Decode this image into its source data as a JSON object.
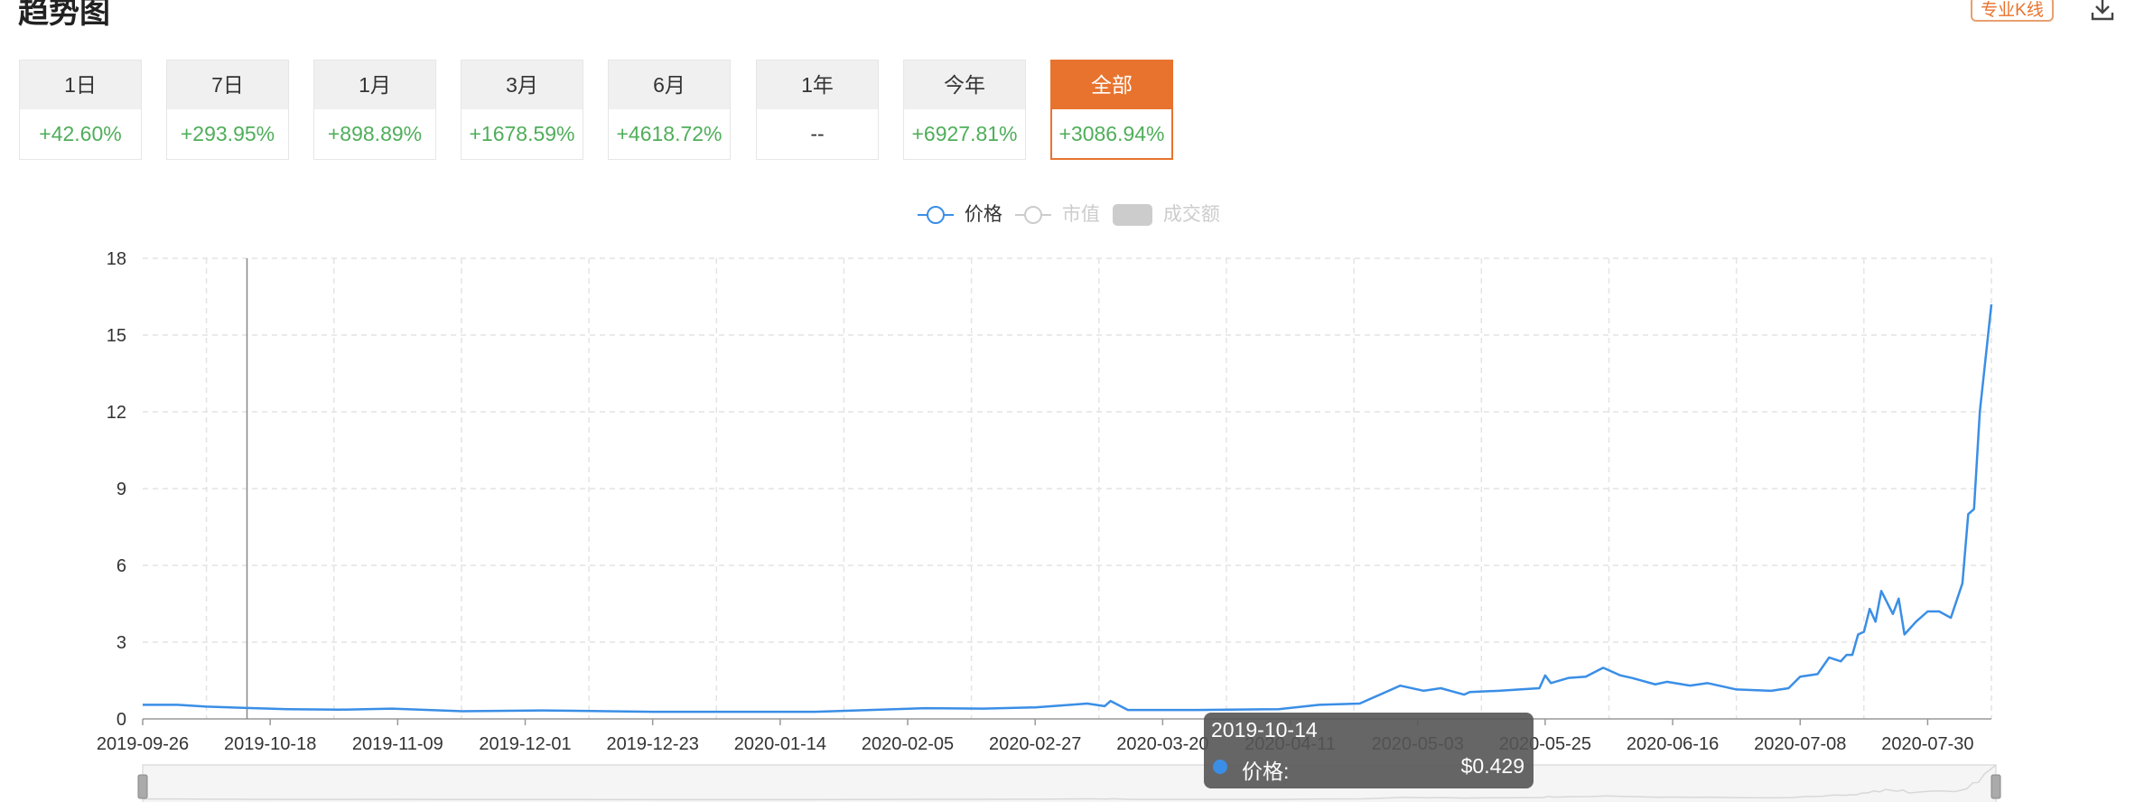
{
  "header": {
    "title": "趋势图",
    "kline_button": "专业K线",
    "download_icon": "download-icon"
  },
  "periods": [
    {
      "label": "1日",
      "change": "+42.60%"
    },
    {
      "label": "7日",
      "change": "+293.95%"
    },
    {
      "label": "1月",
      "change": "+898.89%"
    },
    {
      "label": "3月",
      "change": "+1678.59%"
    },
    {
      "label": "6月",
      "change": "+4618.72%"
    },
    {
      "label": "1年",
      "change": "--"
    },
    {
      "label": "今年",
      "change": "+6927.81%"
    },
    {
      "label": "全部",
      "change": "+3086.94%",
      "active": true
    }
  ],
  "colors": {
    "accent": "#e8732e",
    "positive": "#4fae5a",
    "line": "#3a8ee6",
    "legend_off": "#cccccc"
  },
  "chart_data": {
    "type": "line",
    "legend": [
      {
        "name": "价格",
        "active": true
      },
      {
        "name": "市值",
        "active": false
      },
      {
        "name": "成交额",
        "active": false
      }
    ],
    "start_date": "2019-09-26",
    "x_range_days": [
      0,
      319
    ],
    "ylim": [
      0,
      18
    ],
    "yticks": [
      0,
      3,
      6,
      9,
      12,
      15,
      18
    ],
    "xtick_days": [
      0,
      22,
      44,
      66,
      88,
      110,
      132,
      154,
      176,
      198,
      220,
      242,
      264,
      286,
      308
    ],
    "xtick_labels": [
      "2019-09-26",
      "2019-10-18",
      "2019-11-09",
      "2019-12-01",
      "2019-12-23",
      "2020-01-14",
      "2020-02-05",
      "2020-02-27",
      "2020-03-20",
      "2020-04-11",
      "2020-05-03",
      "2020-05-25",
      "2020-06-16",
      "2020-07-08",
      "2020-07-30"
    ],
    "grid": true,
    "series": [
      {
        "name": "价格",
        "points": [
          [
            0,
            0.55
          ],
          [
            6,
            0.55
          ],
          [
            11,
            0.48
          ],
          [
            18,
            0.43
          ],
          [
            25,
            0.38
          ],
          [
            34,
            0.36
          ],
          [
            43,
            0.4
          ],
          [
            55,
            0.3
          ],
          [
            69,
            0.33
          ],
          [
            88,
            0.28
          ],
          [
            116,
            0.28
          ],
          [
            135,
            0.42
          ],
          [
            145,
            0.4
          ],
          [
            154,
            0.45
          ],
          [
            163,
            0.6
          ],
          [
            166,
            0.5
          ],
          [
            167,
            0.7
          ],
          [
            170,
            0.35
          ],
          [
            182,
            0.35
          ],
          [
            196,
            0.38
          ],
          [
            203,
            0.55
          ],
          [
            210,
            0.6
          ],
          [
            217,
            1.3
          ],
          [
            221,
            1.1
          ],
          [
            224,
            1.2
          ],
          [
            228,
            0.95
          ],
          [
            229,
            1.05
          ],
          [
            234,
            1.1
          ],
          [
            241,
            1.2
          ],
          [
            242,
            1.7
          ],
          [
            243,
            1.4
          ],
          [
            246,
            1.6
          ],
          [
            249,
            1.65
          ],
          [
            252,
            2.0
          ],
          [
            255,
            1.7
          ],
          [
            257,
            1.6
          ],
          [
            261,
            1.35
          ],
          [
            263,
            1.45
          ],
          [
            267,
            1.3
          ],
          [
            270,
            1.4
          ],
          [
            273,
            1.25
          ],
          [
            275,
            1.15
          ],
          [
            281,
            1.1
          ],
          [
            284,
            1.2
          ],
          [
            286,
            1.65
          ],
          [
            289,
            1.75
          ],
          [
            291,
            2.4
          ],
          [
            293,
            2.25
          ],
          [
            294,
            2.5
          ],
          [
            295,
            2.5
          ],
          [
            296,
            3.3
          ],
          [
            297,
            3.4
          ],
          [
            298,
            4.3
          ],
          [
            299,
            3.8
          ],
          [
            300,
            5.0
          ],
          [
            302,
            4.1
          ],
          [
            303,
            4.7
          ],
          [
            304,
            3.3
          ],
          [
            306,
            3.8
          ],
          [
            308,
            4.2
          ],
          [
            310,
            4.2
          ],
          [
            312,
            3.95
          ],
          [
            314,
            5.3
          ],
          [
            315,
            8.0
          ],
          [
            316,
            8.2
          ],
          [
            317,
            12.0
          ],
          [
            319,
            16.2
          ]
        ]
      }
    ],
    "tooltip": {
      "date": "2019-10-14",
      "day": 18,
      "label": "价格:",
      "value": "$0.429"
    }
  }
}
